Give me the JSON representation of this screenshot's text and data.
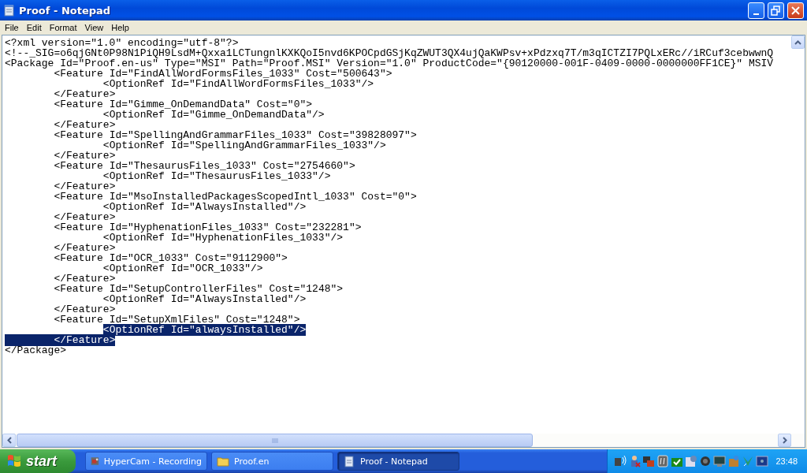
{
  "window": {
    "title": "Proof - Notepad"
  },
  "menu": [
    "File",
    "Edit",
    "Format",
    "View",
    "Help"
  ],
  "document": {
    "lines": [
      {
        "segments": [
          {
            "text": "<?xml version=\"1.0\" encoding=\"utf-8\"?>",
            "selected": false
          }
        ]
      },
      {
        "segments": [
          {
            "text": "<!--_SIG=o6qjGNt0P98N1PiQH9LsdM+Qxxa1LCTungnlKXKQoI5nvd6KPOCpdGSjKqZWUT3QX4ujQaKWPsv+xPdzxq7T/m3qICTZI7PQLxERc//iRCuf3cebwwnQ",
            "selected": false
          }
        ]
      },
      {
        "segments": [
          {
            "text": "<Package Id=\"Proof.en-us\" Type=\"MSI\" Path=\"Proof.MSI\" Version=\"1.0\" ProductCode=\"{90120000-001F-0409-0000-0000000FF1CE}\" MSIV",
            "selected": false
          }
        ]
      },
      {
        "segments": [
          {
            "text": "\t<Feature Id=\"FindAllWordFormsFiles_1033\" Cost=\"500643\">",
            "selected": false
          }
        ]
      },
      {
        "segments": [
          {
            "text": "\t\t<OptionRef Id=\"FindAllWordFormsFiles_1033\"/>",
            "selected": false
          }
        ]
      },
      {
        "segments": [
          {
            "text": "\t</Feature>",
            "selected": false
          }
        ]
      },
      {
        "segments": [
          {
            "text": "\t<Feature Id=\"Gimme_OnDemandData\" Cost=\"0\">",
            "selected": false
          }
        ]
      },
      {
        "segments": [
          {
            "text": "\t\t<OptionRef Id=\"Gimme_OnDemandData\"/>",
            "selected": false
          }
        ]
      },
      {
        "segments": [
          {
            "text": "\t</Feature>",
            "selected": false
          }
        ]
      },
      {
        "segments": [
          {
            "text": "\t<Feature Id=\"SpellingAndGrammarFiles_1033\" Cost=\"39828097\">",
            "selected": false
          }
        ]
      },
      {
        "segments": [
          {
            "text": "\t\t<OptionRef Id=\"SpellingAndGrammarFiles_1033\"/>",
            "selected": false
          }
        ]
      },
      {
        "segments": [
          {
            "text": "\t</Feature>",
            "selected": false
          }
        ]
      },
      {
        "segments": [
          {
            "text": "\t<Feature Id=\"ThesaurusFiles_1033\" Cost=\"2754660\">",
            "selected": false
          }
        ]
      },
      {
        "segments": [
          {
            "text": "\t\t<OptionRef Id=\"ThesaurusFiles_1033\"/>",
            "selected": false
          }
        ]
      },
      {
        "segments": [
          {
            "text": "\t</Feature>",
            "selected": false
          }
        ]
      },
      {
        "segments": [
          {
            "text": "\t<Feature Id=\"MsoInstalledPackagesScopedIntl_1033\" Cost=\"0\">",
            "selected": false
          }
        ]
      },
      {
        "segments": [
          {
            "text": "\t\t<OptionRef Id=\"AlwaysInstalled\"/>",
            "selected": false
          }
        ]
      },
      {
        "segments": [
          {
            "text": "\t</Feature>",
            "selected": false
          }
        ]
      },
      {
        "segments": [
          {
            "text": "\t<Feature Id=\"HyphenationFiles_1033\" Cost=\"232281\">",
            "selected": false
          }
        ]
      },
      {
        "segments": [
          {
            "text": "\t\t<OptionRef Id=\"HyphenationFiles_1033\"/>",
            "selected": false
          }
        ]
      },
      {
        "segments": [
          {
            "text": "\t</Feature>",
            "selected": false
          }
        ]
      },
      {
        "segments": [
          {
            "text": "\t<Feature Id=\"OCR_1033\" Cost=\"9112900\">",
            "selected": false
          }
        ]
      },
      {
        "segments": [
          {
            "text": "\t\t<OptionRef Id=\"OCR_1033\"/>",
            "selected": false
          }
        ]
      },
      {
        "segments": [
          {
            "text": "\t</Feature>",
            "selected": false
          }
        ]
      },
      {
        "segments": [
          {
            "text": "\t<Feature Id=\"SetupControllerFiles\" Cost=\"1248\">",
            "selected": false
          }
        ]
      },
      {
        "segments": [
          {
            "text": "\t\t<OptionRef Id=\"AlwaysInstalled\"/>",
            "selected": false
          }
        ]
      },
      {
        "segments": [
          {
            "text": "\t</Feature>",
            "selected": false
          }
        ]
      },
      {
        "segments": [
          {
            "text": "\t<Feature Id=\"SetupXmlFiles\" Cost=\"1248\">",
            "selected": false
          }
        ]
      },
      {
        "segments": [
          {
            "text": "\t\t<OptionRef Id=\"alwaysInstalled\"/>",
            "selected": true
          }
        ]
      },
      {
        "segments": [
          {
            "text": "\t</Feature>",
            "selected": true
          }
        ]
      },
      {
        "segments": [
          {
            "text": "</Package>",
            "selected": false
          }
        ]
      }
    ]
  },
  "taskbar": {
    "start": "start",
    "tasks": [
      {
        "label": "HyperCam - Recording",
        "kind": "camera",
        "selected": false
      },
      {
        "label": "Proof.en",
        "kind": "folder",
        "selected": false
      },
      {
        "label": "Proof - Notepad",
        "kind": "notepad",
        "selected": true
      }
    ],
    "clock": "23:48"
  }
}
